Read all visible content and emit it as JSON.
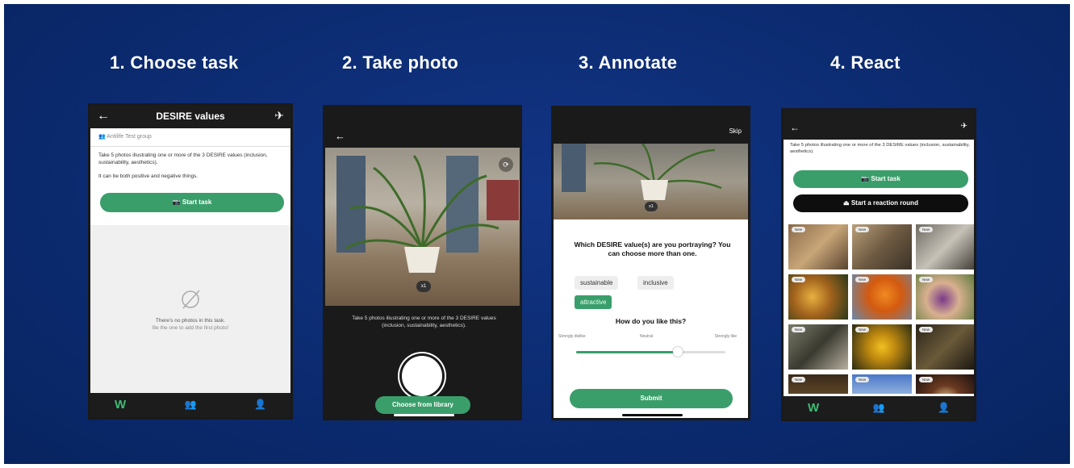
{
  "steps": [
    {
      "title": "1. Choose task"
    },
    {
      "title": "2. Take photo"
    },
    {
      "title": "3. Annotate"
    },
    {
      "title": "4. React"
    }
  ],
  "screen1": {
    "header_title": "DESIRE values",
    "group_label": "Antilife Test group",
    "description": "Take 5 photos illustrating one or more of the 3 DESIRE values (inclusion, sustainability, aesthetics).",
    "note": "It can be both positive and negative things.",
    "start_button": "Start task",
    "empty_line1": "There's no photos in this task.",
    "empty_line2": "Be the one to add the first photo!",
    "nav_logo": "W"
  },
  "screen2": {
    "zoom": "x1",
    "instructions": "Take 5 photos illustrating one or more of the 3 DESIRE values (inclusion, sustainability, aesthetics).",
    "library_button": "Choose from library"
  },
  "screen3": {
    "skip_label": "Skip",
    "zoom": "x1",
    "question": "Which DESIRE value(s) are you portraying? You can choose more than one.",
    "chips": [
      "sustainable",
      "inclusive",
      "attractive"
    ],
    "selected_chip": "attractive",
    "like_question": "How do you like this?",
    "scale_labels": [
      "Strongly dislike",
      "Neutral",
      "Strongly like"
    ],
    "slider_value": 0.68,
    "submit_button": "Submit"
  },
  "screen4": {
    "description": "Take 5 photos illustrating one or more of the 3 DESIRE values (inclusion, sustainability, aesthetics).",
    "start_button": "Start task",
    "reaction_button": "Start a reaction round",
    "new_badge": "New",
    "nav_logo": "W"
  },
  "colors": {
    "background": "#0b2a6f",
    "accent_green": "#3a9e6b",
    "bar_dark": "#1c1c1c"
  }
}
